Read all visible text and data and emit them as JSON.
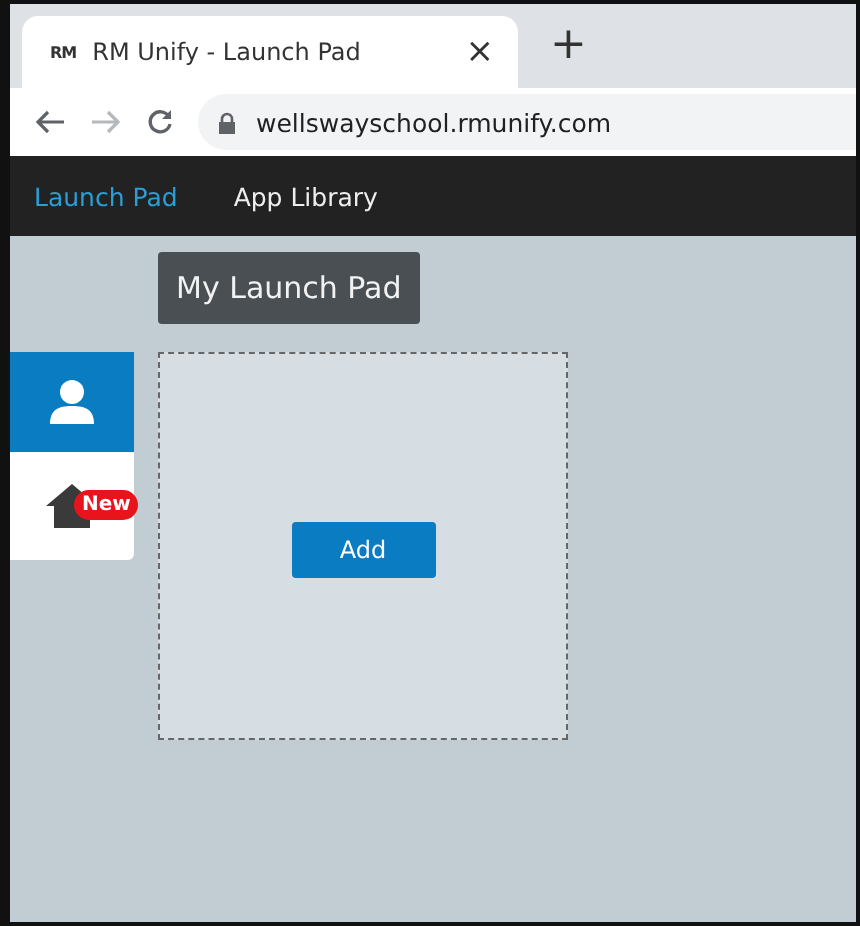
{
  "browser": {
    "tab": {
      "logo": "RM",
      "title": "RM Unify - Launch Pad",
      "close": "×"
    },
    "new_tab": "+",
    "url": "wellswayschool.rmunify.com"
  },
  "nav": [
    {
      "label": "Launch Pad",
      "selected": true
    },
    {
      "label": "App Library",
      "selected": false
    }
  ],
  "heading": "My Launch Pad",
  "side_tabs": [
    {
      "kind": "user",
      "selected": true
    },
    {
      "kind": "home",
      "selected": false,
      "badge": "New"
    }
  ],
  "panel": {
    "button": "Add"
  }
}
